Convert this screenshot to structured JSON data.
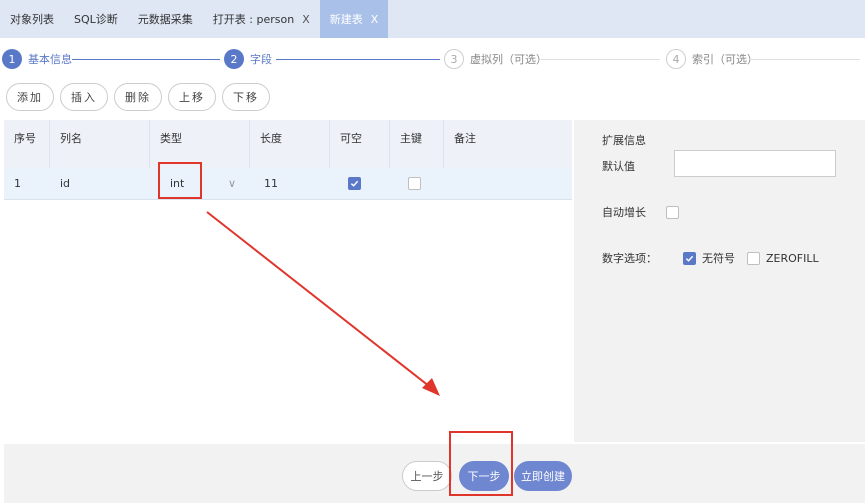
{
  "tabs": [
    {
      "label": "对象列表",
      "active": false,
      "closable": false
    },
    {
      "label": "SQL诊断",
      "active": false,
      "closable": false
    },
    {
      "label": "元数据采集",
      "active": false,
      "closable": false
    },
    {
      "label": "打开表 : person",
      "active": false,
      "closable": true
    },
    {
      "label": "新建表",
      "active": true,
      "closable": true
    }
  ],
  "tab_close_symbol": "X",
  "steps": [
    {
      "num": "1",
      "label": "基本信息",
      "state": "done"
    },
    {
      "num": "2",
      "label": "字段",
      "state": "current"
    },
    {
      "num": "3",
      "label": "虚拟列（可选）",
      "state": "todo"
    },
    {
      "num": "4",
      "label": "索引（可选）",
      "state": "todo"
    }
  ],
  "toolbar": {
    "add": "添加",
    "insert": "插入",
    "delete": "删除",
    "move_up": "上移",
    "move_down": "下移"
  },
  "table": {
    "headers": [
      "序号",
      "列名",
      "类型",
      "长度",
      "可空",
      "主键",
      "备注"
    ],
    "rows": [
      {
        "index": "1",
        "name": "id",
        "type": "int",
        "length": "11",
        "nullable": true,
        "primary_key": false,
        "comment": ""
      }
    ]
  },
  "ext": {
    "title": "扩展信息",
    "default_label": "默认值",
    "default_value": "",
    "auto_inc_label": "自动增长",
    "auto_inc": false,
    "numeric_label": "数字选项：",
    "unsigned_label": "无符号",
    "unsigned": true,
    "zerofill_label": "ZEROFILL",
    "zerofill": false
  },
  "footer": {
    "prev": "上一步",
    "next": "下一步",
    "create": "立即创建"
  },
  "colors": {
    "accent": "#5a78c8",
    "annotation_red": "#e0352b"
  }
}
